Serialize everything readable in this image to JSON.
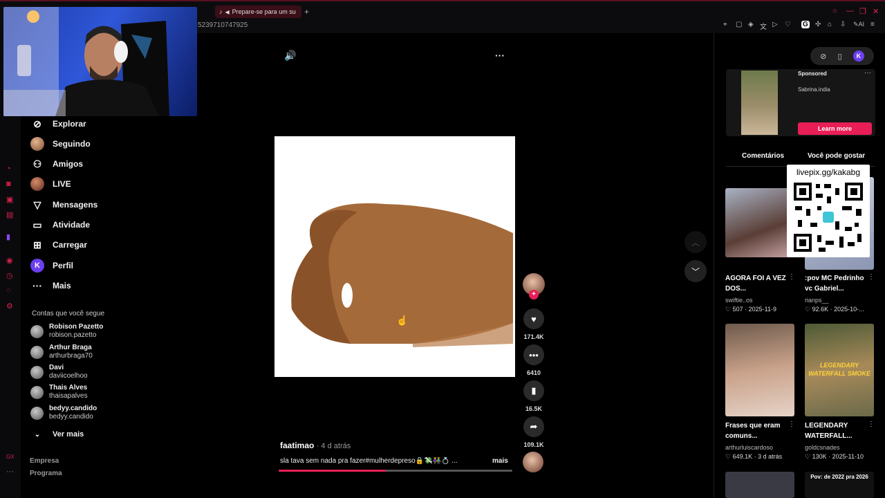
{
  "browser": {
    "tab_label": "Prepare-se para um su",
    "tab_add": "+",
    "url_fragment": "5239710747925"
  },
  "nav": {
    "items": [
      {
        "label": "Explorar",
        "icon": "compass-icon"
      },
      {
        "label": "Seguindo",
        "icon": "avatar"
      },
      {
        "label": "Amigos",
        "icon": "friends-icon"
      },
      {
        "label": "LIVE",
        "icon": "avatar"
      },
      {
        "label": "Mensagens",
        "icon": "send-icon"
      },
      {
        "label": "Atividade",
        "icon": "message-square-icon"
      },
      {
        "label": "Carregar",
        "icon": "plus-square-icon"
      },
      {
        "label": "Perfil",
        "icon": "profile-icon"
      },
      {
        "label": "Mais",
        "icon": "more-icon"
      }
    ],
    "following_title": "Contas que você segue",
    "accounts": [
      {
        "name": "Robison Pazetto",
        "handle": "robison.pazetto"
      },
      {
        "name": "Arthur Braga",
        "handle": "arthurbraga70"
      },
      {
        "name": "Davi",
        "handle": "daviicoelhoo"
      },
      {
        "name": "Thais Alves",
        "handle": "thaisapalves"
      },
      {
        "name": "bedyy.candido",
        "handle": "bedyy.candido"
      }
    ],
    "see_more": "Ver mais",
    "footer_links": [
      "Empresa",
      "Programa"
    ]
  },
  "video": {
    "username": "faatimao",
    "time_ago": "· 4 d atrás",
    "caption": "sla tava sem nada pra fazer#mulherdepreso🔒💸👫💍 ...",
    "more_label": "mais",
    "progress": 0.46
  },
  "actions": {
    "likes": "171.4K",
    "comments": "6410",
    "saves": "16.5K",
    "shares": "109.1K",
    "follow_plus": "+"
  },
  "sidebar_right": {
    "ad": {
      "sponsored": "Sponsored",
      "name": "Sabrina.india",
      "cta": "Learn more",
      "dots": "···"
    },
    "tabs": [
      "Comentários",
      "Você pode gostar"
    ],
    "qr_label": "livepix.gg/kakabg",
    "recommendations": [
      {
        "title": "AGORA FOI A VEZ DOS...",
        "author": "swiftie..os",
        "likes": "507",
        "date": "2025-11-9"
      },
      {
        "title": ":pov MC Pedrinho vc Gabriel...",
        "author": "rianps__",
        "likes": "92.6K",
        "date": "2025-10-..."
      },
      {
        "title": "Frases que eram comuns...",
        "author": "arthurluiscardoso",
        "likes": "649.1K",
        "date": "3 d atrás"
      },
      {
        "title": "LEGENDARY WATERFALL...",
        "author": "goldcsnades",
        "likes": "130K",
        "date": "2025-11-10"
      }
    ],
    "thumb_overlay_text": "LEGENDARY WATERFALL SMOKE",
    "bottom_peek_text": "Pov: de 2022 pra 2026"
  },
  "colors": {
    "accent": "#e91e56",
    "opera_red": "#d6214a"
  }
}
